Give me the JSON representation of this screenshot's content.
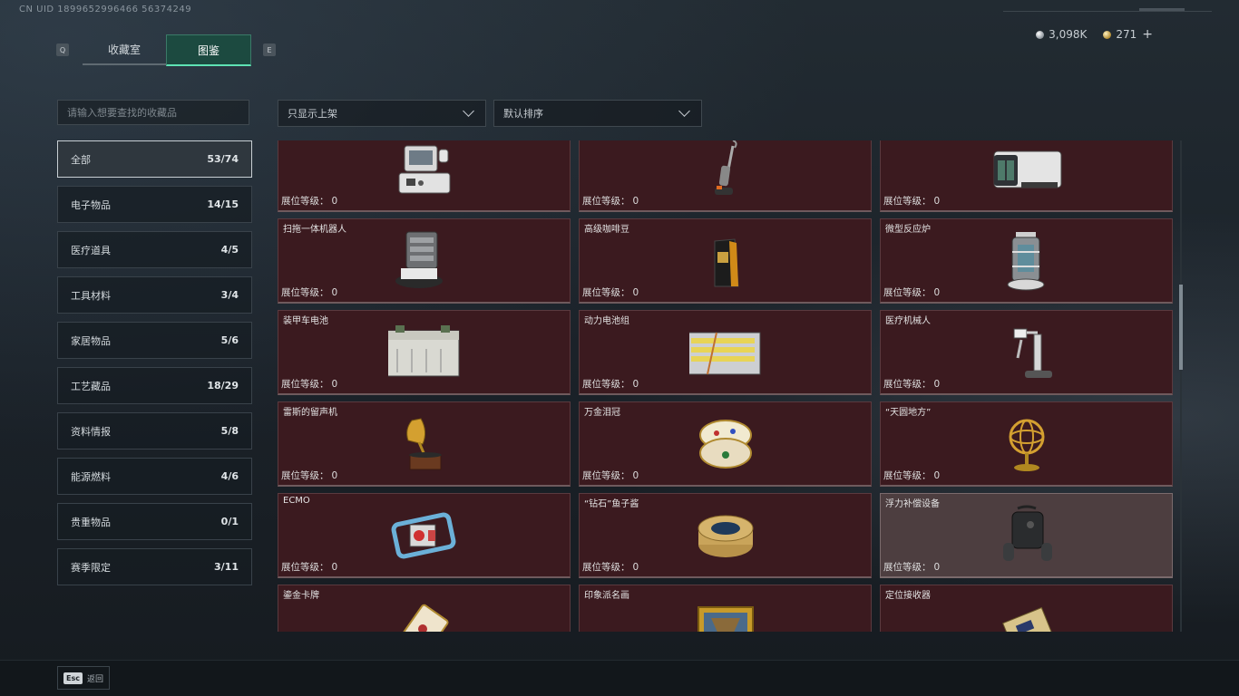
{
  "header": {
    "uid": "CN UID 1899652996466 56374249",
    "tabs": [
      {
        "label": "收藏室",
        "active": false
      },
      {
        "label": "图鉴",
        "active": true
      }
    ],
    "left_key": "Q",
    "right_key": "E",
    "currency": {
      "silver": "3,098K",
      "gold": "271",
      "plus": "+"
    }
  },
  "search": {
    "placeholder": "请输入想要查找的收藏品"
  },
  "filters": {
    "show_filter": "只显示上架",
    "sort": "默认排序"
  },
  "categories": [
    {
      "label": "全部",
      "count": "53/74",
      "active": true
    },
    {
      "label": "电子物品",
      "count": "14/15"
    },
    {
      "label": "医疗道具",
      "count": "4/5"
    },
    {
      "label": "工具材料",
      "count": "3/4"
    },
    {
      "label": "家居物品",
      "count": "5/6"
    },
    {
      "label": "工艺藏品",
      "count": "18/29"
    },
    {
      "label": "资料情报",
      "count": "5/8"
    },
    {
      "label": "能源燃料",
      "count": "4/6"
    },
    {
      "label": "贵重物品",
      "count": "0/1"
    },
    {
      "label": "赛季限定",
      "count": "3/11"
    }
  ],
  "level_label": "展位等级：",
  "items": [
    {
      "name": "",
      "level": "0",
      "icon": "kiosk-terminal-icon"
    },
    {
      "name": "",
      "level": "0",
      "icon": "vacuum-cleaner-icon"
    },
    {
      "name": "",
      "level": "0",
      "icon": "camera-device-icon"
    },
    {
      "name": "扫拖一体机器人",
      "level": "0",
      "icon": "robot-mop-icon"
    },
    {
      "name": "高级咖啡豆",
      "level": "0",
      "icon": "coffee-bag-icon"
    },
    {
      "name": "微型反应炉",
      "level": "0",
      "icon": "reactor-icon"
    },
    {
      "name": "装甲车电池",
      "level": "0",
      "icon": "car-battery-icon"
    },
    {
      "name": "动力电池组",
      "level": "0",
      "icon": "battery-pack-icon"
    },
    {
      "name": "医疗机械人",
      "level": "0",
      "icon": "medical-robot-icon"
    },
    {
      "name": "雷斯的留声机",
      "level": "0",
      "icon": "gramophone-icon"
    },
    {
      "name": "万金泪冠",
      "level": "0",
      "icon": "jeweled-egg-icon"
    },
    {
      "name": "“天圆地方”",
      "level": "0",
      "icon": "armillary-sphere-icon"
    },
    {
      "name": "ECMO",
      "level": "0",
      "icon": "ecmo-machine-icon"
    },
    {
      "name": "“钻石”鱼子酱",
      "level": "0",
      "icon": "caviar-tin-icon"
    },
    {
      "name": "浮力补偿设备",
      "level": "0",
      "icon": "buoyancy-device-icon",
      "gray": true
    },
    {
      "name": "鎏金卡牌",
      "level": "",
      "icon": "gilded-card-icon"
    },
    {
      "name": "印象派名画",
      "level": "",
      "icon": "painting-icon"
    },
    {
      "name": "定位接收器",
      "level": "",
      "icon": "gps-receiver-icon"
    }
  ],
  "footer": {
    "esc_key": "Esc",
    "esc_label": "返回"
  }
}
